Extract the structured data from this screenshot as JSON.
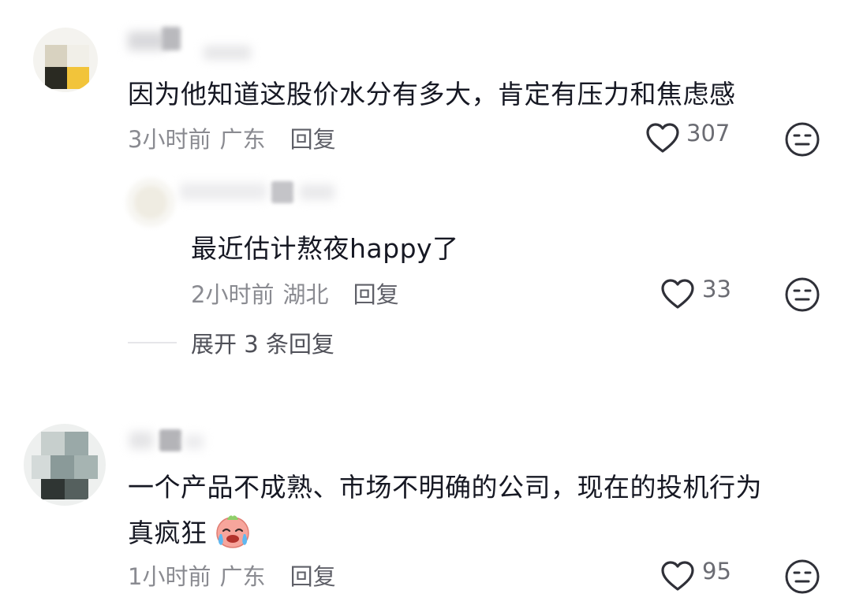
{
  "comments": [
    {
      "text": "因为他知道这股价水分有多大，肯定有压力和焦虑感",
      "time": "3小时前",
      "location": "广东",
      "reply_label": "回复",
      "likes": "307",
      "replies": [
        {
          "text": "最近估计熬夜happy了",
          "time": "2小时前",
          "location": "湖北",
          "reply_label": "回复",
          "likes": "33"
        }
      ],
      "expand_label": "展开 3 条回复"
    },
    {
      "text_line1": "一个产品不成熟、市场不明确的公司，现在的投机行为",
      "text_line2": "真疯狂",
      "time": "1小时前",
      "location": "广东",
      "reply_label": "回复",
      "likes": "95"
    }
  ],
  "icons": {
    "like": "heart-outline-icon",
    "dislike": "meh-face-icon",
    "emoji": "crying-face-emoji"
  },
  "colors": {
    "primary_text": "#161823",
    "meta_text": "#8a8b91",
    "icon_stroke": "#2f3038"
  }
}
